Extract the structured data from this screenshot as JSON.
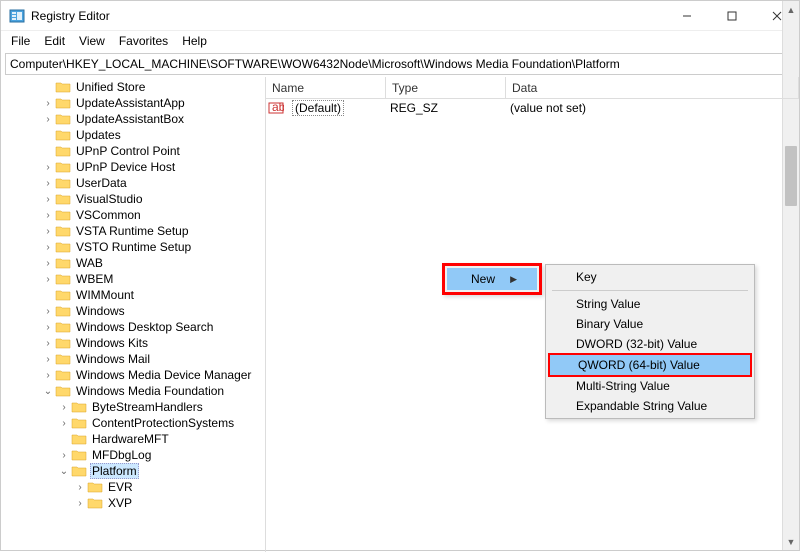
{
  "window": {
    "title": "Registry Editor"
  },
  "menubar": [
    "File",
    "Edit",
    "View",
    "Favorites",
    "Help"
  ],
  "address": "Computer\\HKEY_LOCAL_MACHINE\\SOFTWARE\\WOW6432Node\\Microsoft\\Windows Media Foundation\\Platform",
  "columns": {
    "name": "Name",
    "type": "Type",
    "data": "Data"
  },
  "values": [
    {
      "name": "(Default)",
      "type": "REG_SZ",
      "data": "(value not set)"
    }
  ],
  "tree": [
    {
      "label": "Unified Store",
      "expander": ""
    },
    {
      "label": "UpdateAssistantApp",
      "expander": "›"
    },
    {
      "label": "UpdateAssistantBox",
      "expander": "›"
    },
    {
      "label": "Updates",
      "expander": ""
    },
    {
      "label": "UPnP Control Point",
      "expander": ""
    },
    {
      "label": "UPnP Device Host",
      "expander": "›"
    },
    {
      "label": "UserData",
      "expander": "›"
    },
    {
      "label": "VisualStudio",
      "expander": "›"
    },
    {
      "label": "VSCommon",
      "expander": "›"
    },
    {
      "label": "VSTA Runtime Setup",
      "expander": "›"
    },
    {
      "label": "VSTO Runtime Setup",
      "expander": "›"
    },
    {
      "label": "WAB",
      "expander": "›"
    },
    {
      "label": "WBEM",
      "expander": "›"
    },
    {
      "label": "WIMMount",
      "expander": ""
    },
    {
      "label": "Windows",
      "expander": "›"
    },
    {
      "label": "Windows Desktop Search",
      "expander": "›"
    },
    {
      "label": "Windows Kits",
      "expander": "›"
    },
    {
      "label": "Windows Mail",
      "expander": "›"
    },
    {
      "label": "Windows Media Device Manager",
      "expander": "›"
    },
    {
      "label": "Windows Media Foundation",
      "expander": "⌄",
      "selectedChild": true,
      "children": [
        {
          "label": "ByteStreamHandlers",
          "expander": "›"
        },
        {
          "label": "ContentProtectionSystems",
          "expander": "›"
        },
        {
          "label": "HardwareMFT",
          "expander": ""
        },
        {
          "label": "MFDbgLog",
          "expander": "›"
        },
        {
          "label": "Platform",
          "expander": "⌄",
          "selected": true,
          "children": [
            {
              "label": "EVR",
              "expander": "›"
            },
            {
              "label": "XVP",
              "expander": "›"
            }
          ]
        }
      ]
    }
  ],
  "contextMenu": {
    "primary": {
      "label": "New"
    },
    "sub": [
      "Key",
      "-",
      "String Value",
      "Binary Value",
      "DWORD (32-bit) Value",
      "QWORD (64-bit) Value",
      "Multi-String Value",
      "Expandable String Value"
    ],
    "highlighted": "QWORD (64-bit) Value"
  }
}
